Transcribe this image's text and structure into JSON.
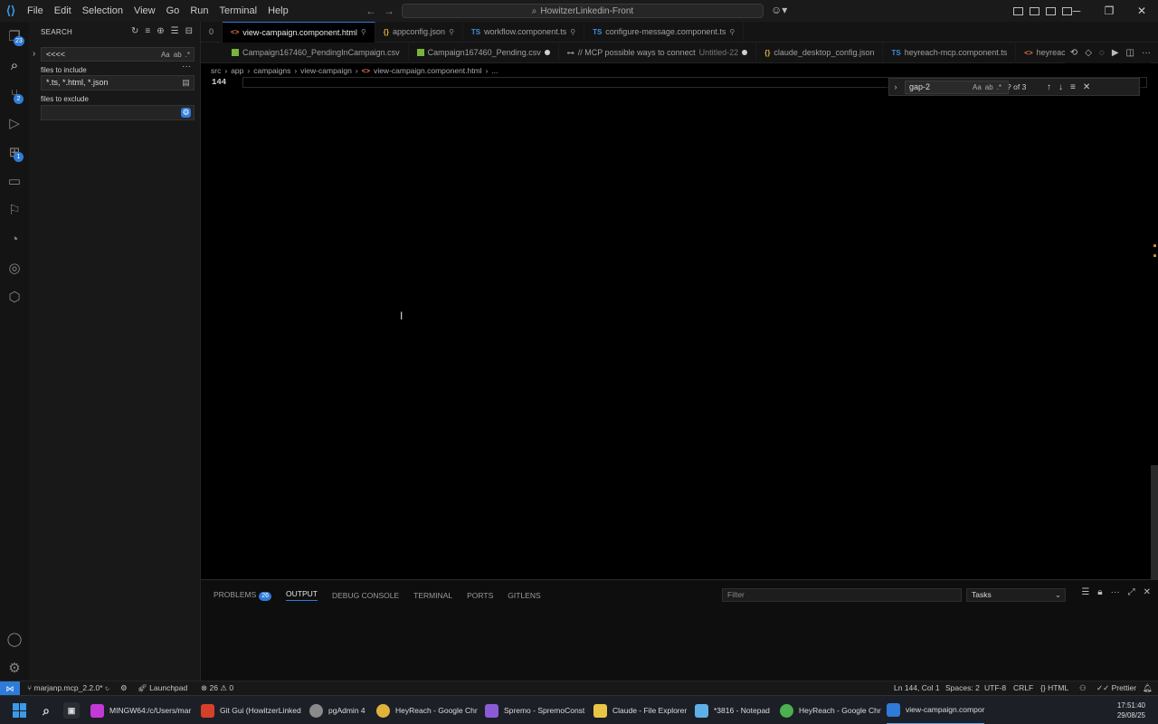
{
  "titlebar": {
    "menu": [
      "File",
      "Edit",
      "Selection",
      "View",
      "Go",
      "Run",
      "Terminal",
      "Help"
    ],
    "command_center": "HowitzerLinkedin-Front"
  },
  "activity_bar": {
    "explorer_badge": "23",
    "source_control_badge": "2",
    "extensions_badge": "1"
  },
  "sidebar": {
    "title": "SEARCH",
    "search_value": "<<<<",
    "include_label": "files to include",
    "include_value": "*.ts, *.html, *.json",
    "exclude_label": "files to exclude",
    "exclude_value": ""
  },
  "tabs_row1": [
    {
      "label": "0",
      "icon": "",
      "pinned": false
    },
    {
      "label": "view-campaign.component.html",
      "icon": "html",
      "pinned": true,
      "active": true
    },
    {
      "label": "appconfig.json",
      "icon": "json",
      "pinned": true
    },
    {
      "label": "workflow.component.ts",
      "icon": "ts",
      "pinned": true
    },
    {
      "label": "configure-message.component.ts",
      "icon": "ts",
      "pinned": true
    }
  ],
  "tabs_row2": [
    {
      "label": "Campaign167460_PendingInCampaign.csv",
      "icon": "csv"
    },
    {
      "label": "Campaign167460_Pending.csv",
      "icon": "csv",
      "dirty": true
    },
    {
      "label": "// MCP possible ways to connect",
      "icon": "mcp",
      "extra": "Untitled-22",
      "dirty": true
    },
    {
      "label": "claude_desktop_config.json",
      "icon": "json"
    },
    {
      "label": "heyreach-mcp.component.ts",
      "icon": "ts"
    },
    {
      "label": "heyreach-",
      "icon": "html"
    }
  ],
  "breadcrumb": [
    "src",
    "app",
    "campaigns",
    "view-campaign",
    "view-campaign.component.html",
    "..."
  ],
  "editor": {
    "line_number": "144"
  },
  "find_widget": {
    "query": "gap-2",
    "match_count": "? of 3",
    "opt_case": "Aa",
    "opt_word": "ab",
    "opt_regex": ".*"
  },
  "panel": {
    "tabs": [
      "PROBLEMS",
      "OUTPUT",
      "DEBUG CONSOLE",
      "TERMINAL",
      "PORTS",
      "GITLENS"
    ],
    "problems_count": "26",
    "active_tab": "OUTPUT",
    "filter_placeholder": "Filter",
    "select_value": "Tasks"
  },
  "statusbar": {
    "branch": "marjanp.mcp_2.2.0*",
    "launchpad": "Launchpad",
    "errors": "26",
    "warnings": "0",
    "position": "Ln 144, Col 1",
    "spaces": "Spaces: 2",
    "encoding": "UTF-8",
    "eol": "CRLF",
    "language": "HTML",
    "prettier": "Prettier"
  },
  "taskbar": {
    "apps": [
      {
        "label": "MINGW64:/c/Users/mar",
        "color": "#c23ad6"
      },
      {
        "label": "Git Gui (HowitzerLinked",
        "color": "#d6402b"
      },
      {
        "label": "pgAdmin 4",
        "color": "#8a8a8a"
      },
      {
        "label": "HeyReach - Google Chr",
        "color": "#e0b23b"
      },
      {
        "label": "Spremo - SpremoConst",
        "color": "#8b5bd6"
      },
      {
        "label": "Claude - File Explorer",
        "color": "#e8c547"
      },
      {
        "label": "*3816 - Notepad",
        "color": "#5fb0e8"
      },
      {
        "label": "HeyReach - Google Chr",
        "color": "#4caf50"
      },
      {
        "label": "view-campaign.compor",
        "color": "#2f7bd9"
      }
    ],
    "time": "17:51:40",
    "date": "29/08/25"
  }
}
